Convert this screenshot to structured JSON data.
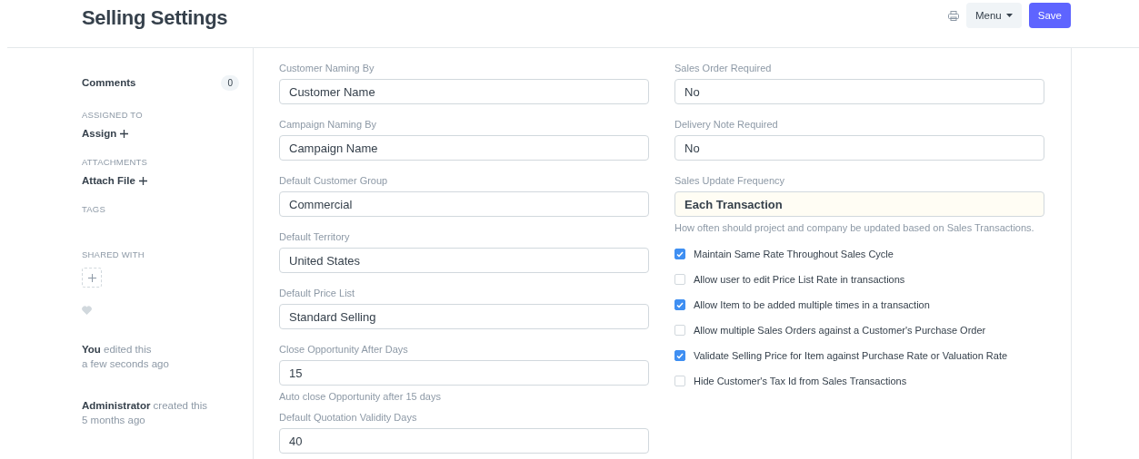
{
  "title": "Selling Settings",
  "actions": {
    "menu": "Menu",
    "save": "Save"
  },
  "sidebar": {
    "comments": {
      "label": "Comments",
      "count": "0"
    },
    "sections": [
      {
        "kind": "link",
        "heading": "ASSIGNED TO",
        "link": "Assign"
      },
      {
        "kind": "link",
        "heading": "ATTACHMENTS",
        "link": "Attach File"
      },
      {
        "kind": "empty",
        "heading": "TAGS"
      },
      {
        "kind": "share",
        "heading": "SHARED WITH"
      }
    ],
    "liked": false,
    "activity": [
      {
        "who": "You",
        "what": "edited this",
        "when": "a few seconds ago"
      },
      {
        "who": "Administrator",
        "what": "created this",
        "when": "5 months ago"
      }
    ]
  },
  "left_fields": [
    {
      "label": "Customer Naming By",
      "value": "Customer Name"
    },
    {
      "label": "Campaign Naming By",
      "value": "Campaign Name"
    },
    {
      "label": "Default Customer Group",
      "value": "Commercial"
    },
    {
      "label": "Default Territory",
      "value": "United States"
    },
    {
      "label": "Default Price List",
      "value": "Standard Selling"
    },
    {
      "label": "Close Opportunity After Days",
      "value": "15",
      "help": "Auto close Opportunity after 15 days"
    },
    {
      "label": "Default Quotation Validity Days",
      "value": "40"
    }
  ],
  "right_fields": [
    {
      "label": "Sales Order Required",
      "value": "No",
      "highlighted": false
    },
    {
      "label": "Delivery Note Required",
      "value": "No",
      "highlighted": false
    },
    {
      "label": "Sales Update Frequency",
      "value": "Each Transaction",
      "highlighted": true,
      "help": "How often should project and company be updated based on Sales Transactions."
    }
  ],
  "checkboxes": [
    {
      "label": "Maintain Same Rate Throughout Sales Cycle",
      "checked": true
    },
    {
      "label": "Allow user to edit Price List Rate in transactions",
      "checked": false
    },
    {
      "label": "Allow Item to be added multiple times in a transaction",
      "checked": true
    },
    {
      "label": "Allow multiple Sales Orders against a Customer's Purchase Order",
      "checked": false
    },
    {
      "label": "Validate Selling Price for Item against Purchase Rate or Valuation Rate",
      "checked": true
    },
    {
      "label": "Hide Customer's Tax Id from Sales Transactions",
      "checked": false
    }
  ]
}
